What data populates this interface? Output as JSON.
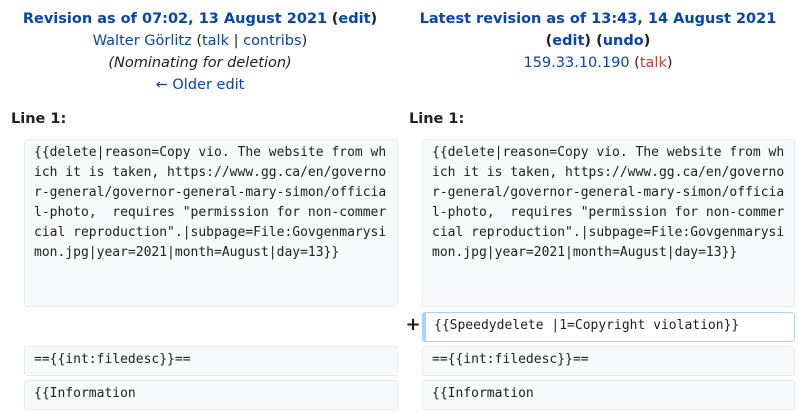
{
  "left_header": {
    "title": "Revision as of 07:02, 13 August 2021",
    "edit_link": "edit",
    "user": "Walter Görlitz",
    "talk_link": "talk",
    "separator": "|",
    "contribs_link": "contribs",
    "summary": "(Nominating for deletion)",
    "older_edit": "← Older edit"
  },
  "right_header": {
    "title": "Latest revision as of 13:43, 14 August 2021",
    "edit_link": "edit",
    "undo_link": "undo",
    "user_ip": "159.33.10.190",
    "talk_link": "talk"
  },
  "line_label": "Line 1:",
  "left_lines": [
    "{{delete|reason=Copy vio. The website from which it is taken, https://www.gg.ca/en/governor-general/governor-general-mary-simon/official-photo,  requires \"permission for non-commercial reproduction\".|subpage=File:Govgenmarysimon.jpg|year=2021|month=August|day=13}}",
    "=={{int:filedesc}}==",
    "{{Information"
  ],
  "right_lines": [
    "{{delete|reason=Copy vio. The website from which it is taken, https://www.gg.ca/en/governor-general/governor-general-mary-simon/official-photo,  requires \"permission for non-commercial reproduction\".|subpage=File:Govgenmarysimon.jpg|year=2021|month=August|day=13}}",
    "=={{int:filedesc}}==",
    "{{Information"
  ],
  "added_marker": "+",
  "added_line": "{{Speedydelete |1=Copyright violation}}"
}
